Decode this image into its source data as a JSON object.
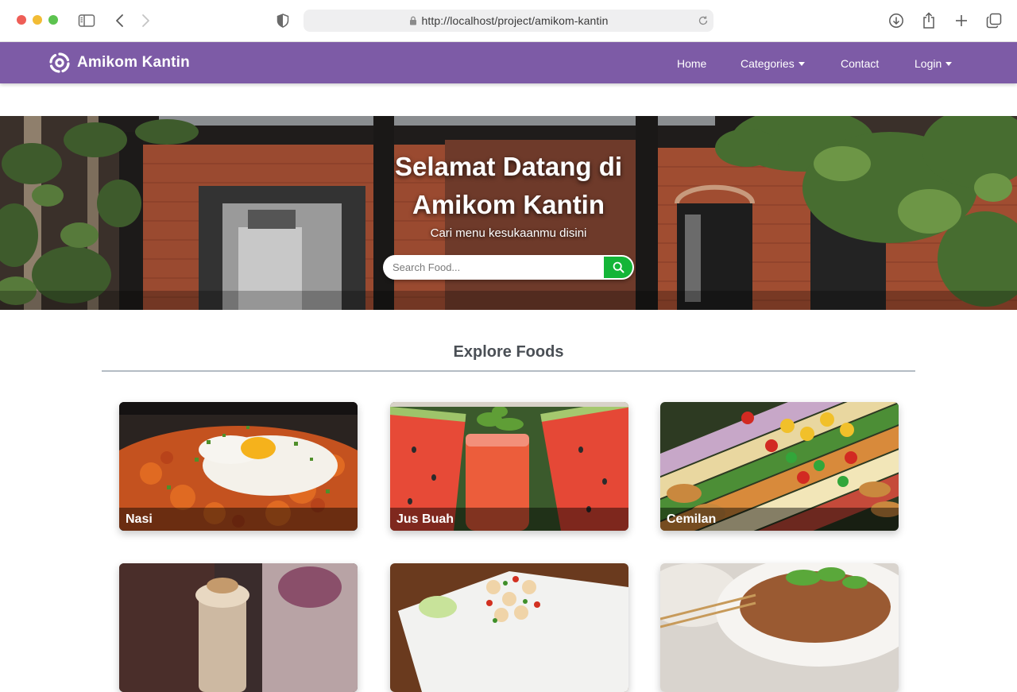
{
  "browser": {
    "url": "http://localhost/project/amikom-kantin",
    "icons": [
      "sidebar-icon",
      "back-icon",
      "forward-icon",
      "shield-icon",
      "lock-icon",
      "reload-icon",
      "download-icon",
      "share-icon",
      "new-tab-icon",
      "tabs-overview-icon"
    ]
  },
  "navbar": {
    "brand": "Amikom Kantin",
    "links": [
      {
        "label": "Home",
        "dropdown": false
      },
      {
        "label": "Categories",
        "dropdown": true
      },
      {
        "label": "Contact",
        "dropdown": false
      },
      {
        "label": "Login",
        "dropdown": true
      }
    ]
  },
  "hero": {
    "title_line1": "Selamat Datang di",
    "title_line2": "Amikom Kantin",
    "subtitle": "Cari menu kesukaanmu disini",
    "search_placeholder": "Search Food..."
  },
  "explore": {
    "title": "Explore Foods",
    "cards": [
      {
        "label": "Nasi"
      },
      {
        "label": "Jus Buah"
      },
      {
        "label": "Cemilan"
      },
      {
        "label": ""
      },
      {
        "label": ""
      },
      {
        "label": ""
      }
    ]
  },
  "colors": {
    "navbar": "#7d5ba6",
    "search_button": "#14b538",
    "section_title": "#4a4f55"
  }
}
